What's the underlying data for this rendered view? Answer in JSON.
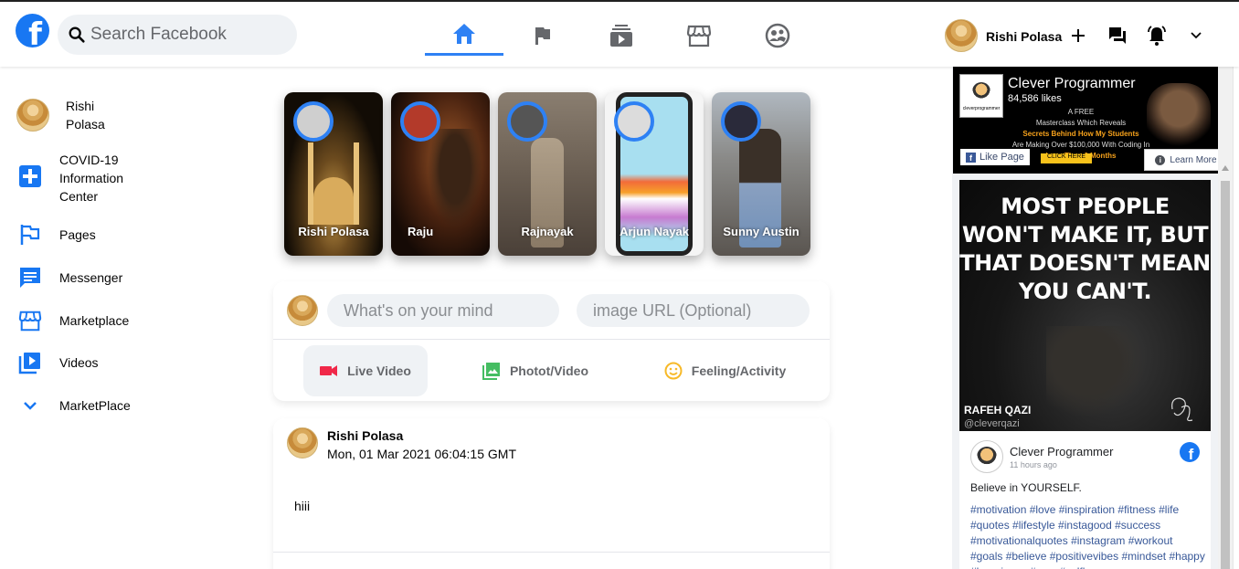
{
  "header": {
    "search_placeholder": "Search Facebook",
    "user_name": "Rishi Polasa"
  },
  "sidebar": {
    "profile_name": "Rishi Polasa",
    "items": [
      {
        "label": "COVID-19 Information Center",
        "icon": "plus-square-icon"
      },
      {
        "label": "Pages",
        "icon": "flag-icon"
      },
      {
        "label": "Messenger",
        "icon": "chat-icon"
      },
      {
        "label": "Marketplace",
        "icon": "storefront-icon"
      },
      {
        "label": "Videos",
        "icon": "video-library-icon"
      },
      {
        "label": "MarketPlace",
        "icon": "chevron-down-icon"
      }
    ]
  },
  "stories": [
    {
      "name": "Rishi Polasa"
    },
    {
      "name": "Raju"
    },
    {
      "name": "Rajnayak"
    },
    {
      "name": "Arjun Nayak"
    },
    {
      "name": "Sunny Austin"
    }
  ],
  "composer": {
    "message_placeholder": "What's on your mind",
    "image_placeholder": "image URL (Optional)",
    "options": [
      {
        "label": "Live Video"
      },
      {
        "label": "Photot/Video"
      },
      {
        "label": "Feeling/Activity"
      }
    ]
  },
  "post": {
    "author": "Rishi Polasa",
    "timestamp": "Mon, 01 Mar 2021 06:04:15 GMT",
    "text": "hiii"
  },
  "widget": {
    "page_name": "Clever Programmer",
    "likes": "84,586 likes",
    "promo_line1": "A FREE",
    "promo_line2": "Masterclass Which Reveals",
    "promo_line3": "Secrets Behind How My Students",
    "promo_line4": "Are Making Over $100,000 With Coding In",
    "promo_line5": "Less Than 6 Months",
    "like_page_label": "Like Page",
    "click_here_label": "CLICK HERE",
    "learn_more_label": "Learn More",
    "quote": "MOST PEOPLE WON'T MAKE IT, BUT THAT DOESN'T MEAN YOU CAN'T.",
    "quote_author": "RAFEH QAZI",
    "quote_handle": "@cleverqazi",
    "post_author": "Clever Programmer",
    "post_time": "11 hours ago",
    "post_text": "Believe in YOURSELF.",
    "post_tags": "#motivation #love #inspiration #fitness #life #quotes #lifestyle #instagood #success #motivationalquotes #instagram #workout #goals #believe #positivevibes #mindset #happy #happiness #gym #selflove"
  },
  "colors": {
    "brand_blue": "#1877f2",
    "story_ring": "#2e81f4",
    "live_red": "#f02849",
    "photo_green": "#45bd62",
    "feeling_yellow": "#f7b928"
  }
}
